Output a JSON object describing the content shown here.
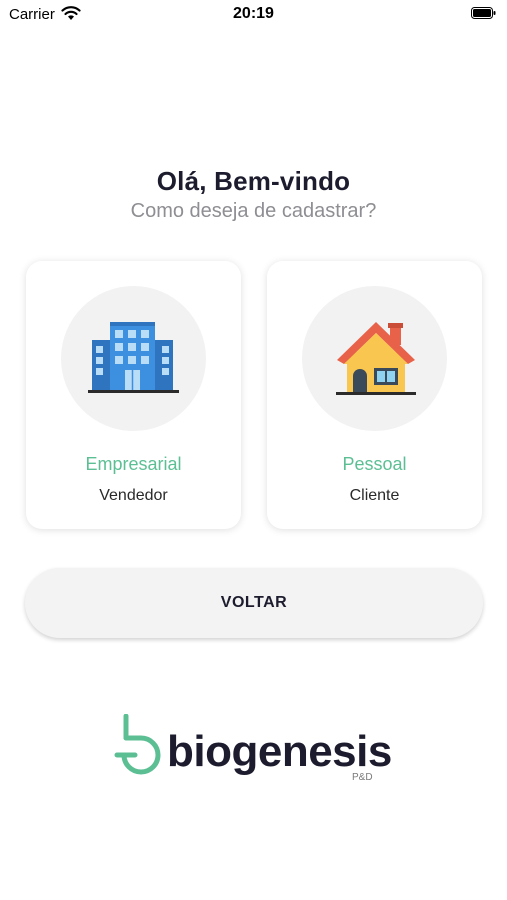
{
  "status_bar": {
    "carrier": "Carrier",
    "time": "20:19"
  },
  "header": {
    "title": "Olá, Bem-vindo",
    "subtitle": "Como deseja de cadastrar?"
  },
  "options": [
    {
      "title": "Empresarial",
      "subtitle": "Vendedor",
      "icon": "office-building-icon"
    },
    {
      "title": "Pessoal",
      "subtitle": "Cliente",
      "icon": "house-icon"
    }
  ],
  "back_button": {
    "label": "VOLTAR"
  },
  "logo": {
    "name": "biogenesis",
    "tagline": "P&D"
  },
  "colors": {
    "accent": "#5cbf94",
    "text_dark": "#1c1c2e",
    "muted": "#8e8e93",
    "card_bg": "#ffffff",
    "button_bg": "#f3f3f3"
  }
}
